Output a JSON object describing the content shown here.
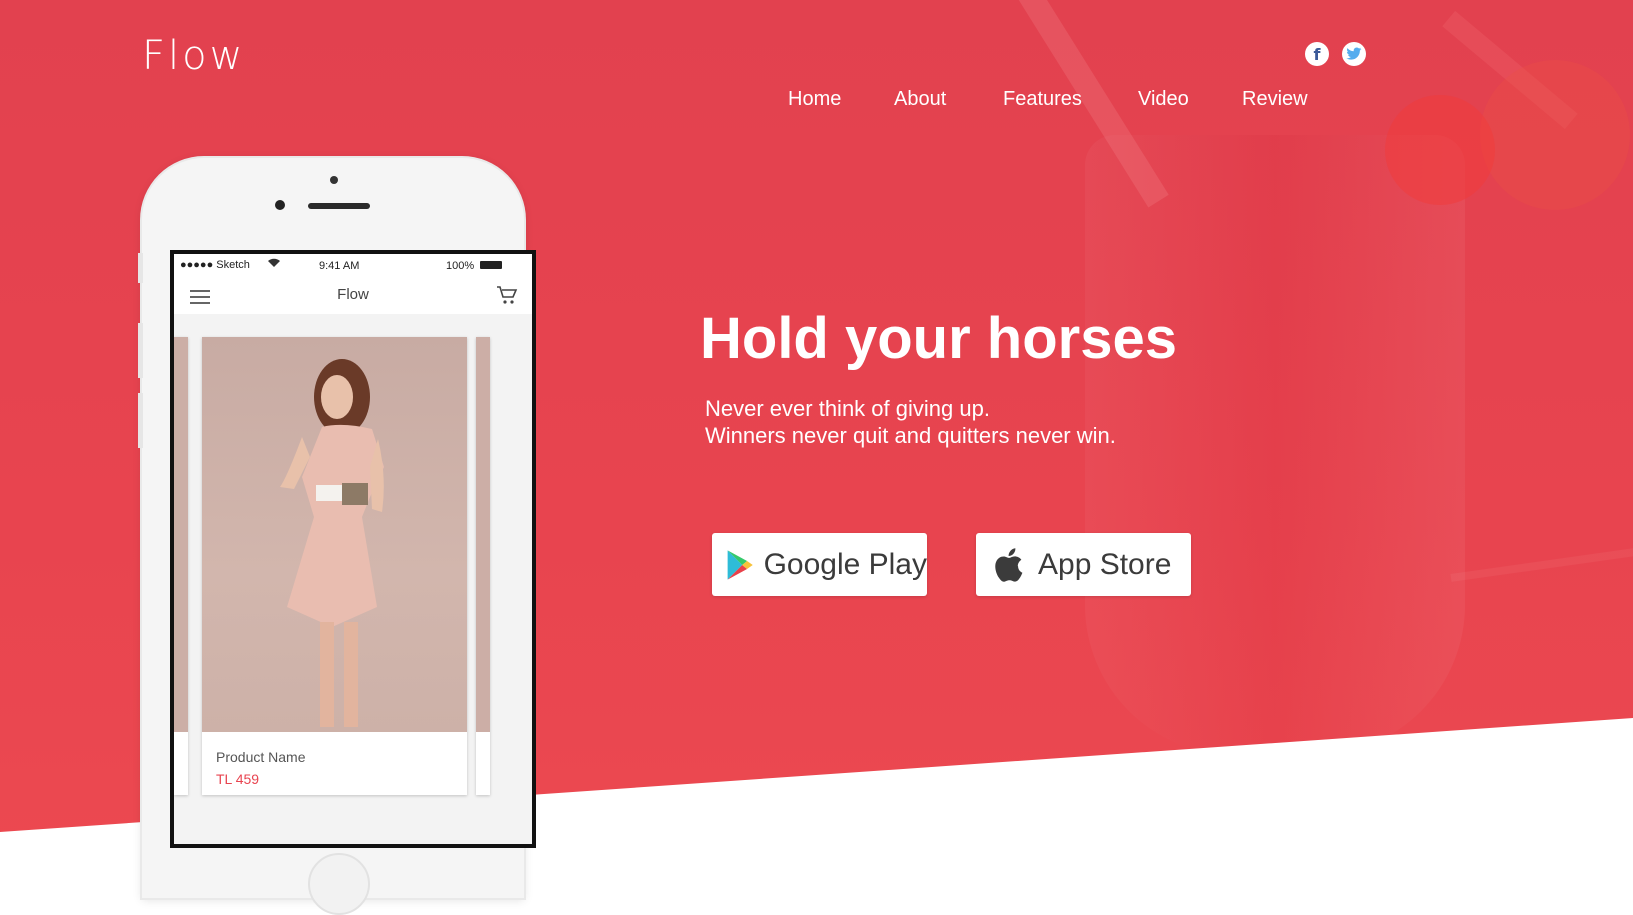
{
  "brand": {
    "logo": "Flow"
  },
  "nav": {
    "items": [
      {
        "label": "Home"
      },
      {
        "label": "About"
      },
      {
        "label": "Features"
      },
      {
        "label": "Video"
      },
      {
        "label": "Review"
      }
    ],
    "social": [
      {
        "icon": "facebook-icon",
        "glyph": "f",
        "color": "#3b5998"
      },
      {
        "icon": "twitter-icon",
        "color": "#55acee"
      }
    ]
  },
  "hero": {
    "headline": "Hold your horses",
    "subtitle_lines": [
      "Never ever think of giving up.",
      "Winners never quit and quitters never win."
    ],
    "colors": {
      "background": "#e8444f"
    }
  },
  "stores": {
    "google": {
      "label": "Google Play",
      "icon": "google-play-icon"
    },
    "apple": {
      "label": "App Store",
      "icon": "apple-icon"
    }
  },
  "phone": {
    "status": {
      "carrier": "●●●●● Sketch",
      "time": "9:41 AM",
      "battery": "100%"
    },
    "app_title": "Flow",
    "product": {
      "name": "Product Name",
      "price": "TL 459"
    },
    "colors": {
      "price": "#e84450"
    }
  }
}
